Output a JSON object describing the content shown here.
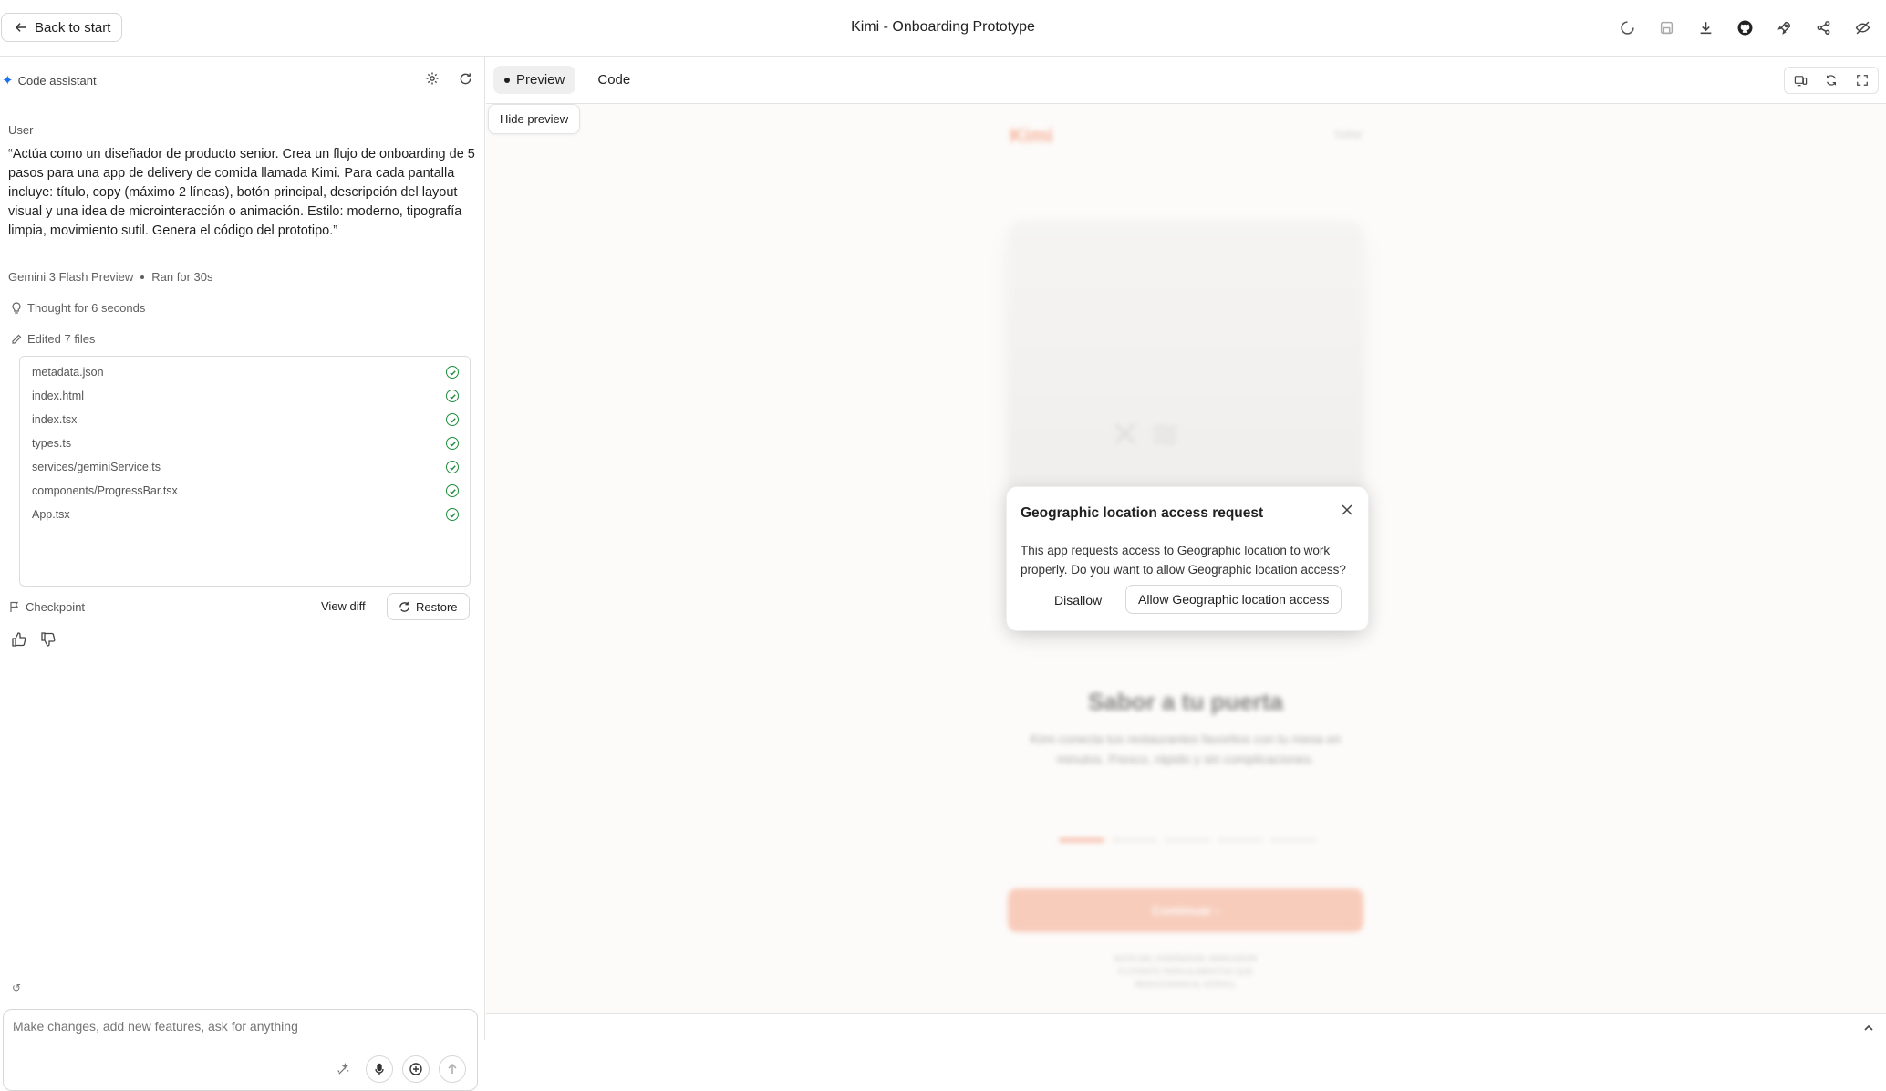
{
  "header": {
    "back_label": "Back to start",
    "title": "Kimi - Onboarding Prototype",
    "icons": [
      "loading-icon",
      "save-icon",
      "download-icon",
      "github-icon",
      "deploy-rocket-icon",
      "share-icon",
      "hide-icon"
    ]
  },
  "assistant": {
    "title": "Code assistant",
    "user_label": "User",
    "prompt": "“Actúa como un diseñador de producto senior. Crea un flujo de onboarding de 5 pasos para una app de delivery de comida llamada Kimi. Para cada pantalla incluye: título, copy (máximo 2 líneas), botón principal, descripción del layout visual y una idea de microinteracción o animación. Estilo: moderno, tipografía limpia, movimiento sutil. Genera el código del prototipo.”",
    "model": "Gemini 3 Flash Preview",
    "ran_for": "Ran for 30s",
    "thought": "Thought for 6 seconds",
    "edited": "Edited 7 files",
    "files": [
      "metadata.json",
      "index.html",
      "index.tsx",
      "types.ts",
      "services/geminiService.ts",
      "components/ProgressBar.tsx",
      "App.tsx"
    ],
    "checkpoint": "Checkpoint",
    "view_diff": "View diff",
    "restore": "Restore",
    "input_placeholder": "Make changes, add new features, ask for anything"
  },
  "preview": {
    "tabs": [
      "Preview",
      "Code"
    ],
    "hide_preview": "Hide preview",
    "app": {
      "logo": "Kimi",
      "skip": "Saltar",
      "title": "Sabor a tu puerta",
      "copy": "Kimi conecta tus restaurantes favoritos con tu mesa en minutos. Fresco, rápido y sin complicaciones.",
      "cta": "Continuar",
      "note": "NOTA DEL DISEÑADOR: MARCADOR FLOTANTE PARA ALIMENTOS QUE REACCIONAN AL SCROLL",
      "steps_total": 5,
      "step_current": 1
    },
    "dialog": {
      "title": "Geographic location access request",
      "body": "This app requests access to Geographic location to work properly. Do you want to allow Geographic location access?",
      "disallow": "Disallow",
      "allow": "Allow Geographic location access"
    }
  },
  "colors": {
    "accent": "#f27b51",
    "check": "#1e8e3e",
    "assistant_spark": "#1a73e8"
  }
}
